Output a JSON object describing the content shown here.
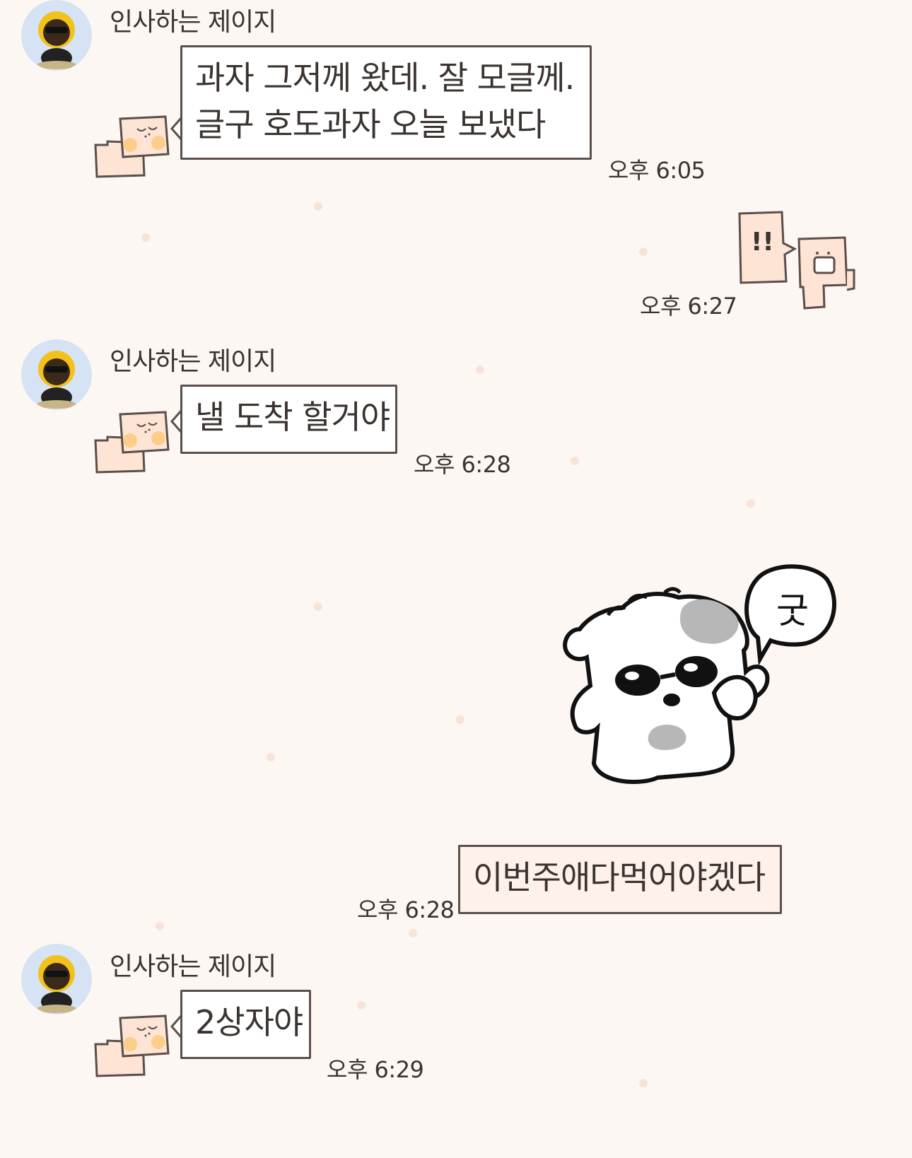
{
  "messages": [
    {
      "sender": "인사하는 제이지",
      "text_line1": "과자 그저께 왔데.  잘 모글께.",
      "text_line2": "글구 호도과자 오늘 보냈다",
      "time": "오후 6:05"
    },
    {
      "sticker": "!!",
      "time": "오후 6:27"
    },
    {
      "sender": "인사하는 제이지",
      "text": "낼 도착 할거야",
      "time": "오후 6:28"
    },
    {
      "sticker_text": "굿",
      "mine_text": "이번주애다먹어야겠다",
      "time": "오후 6:28"
    },
    {
      "sender": "인사하는 제이지",
      "text": "2상자야",
      "time": "오후 6:29"
    }
  ],
  "icons": {
    "avatar": "ryan-avatar-icon",
    "bubble_deco": "box-character-icon",
    "sticker": "puppy-sticker"
  },
  "colors": {
    "background": "#fdf7f3",
    "bubble_border": "#5a4f4b",
    "avatar_bg": "#d5e3f4"
  }
}
